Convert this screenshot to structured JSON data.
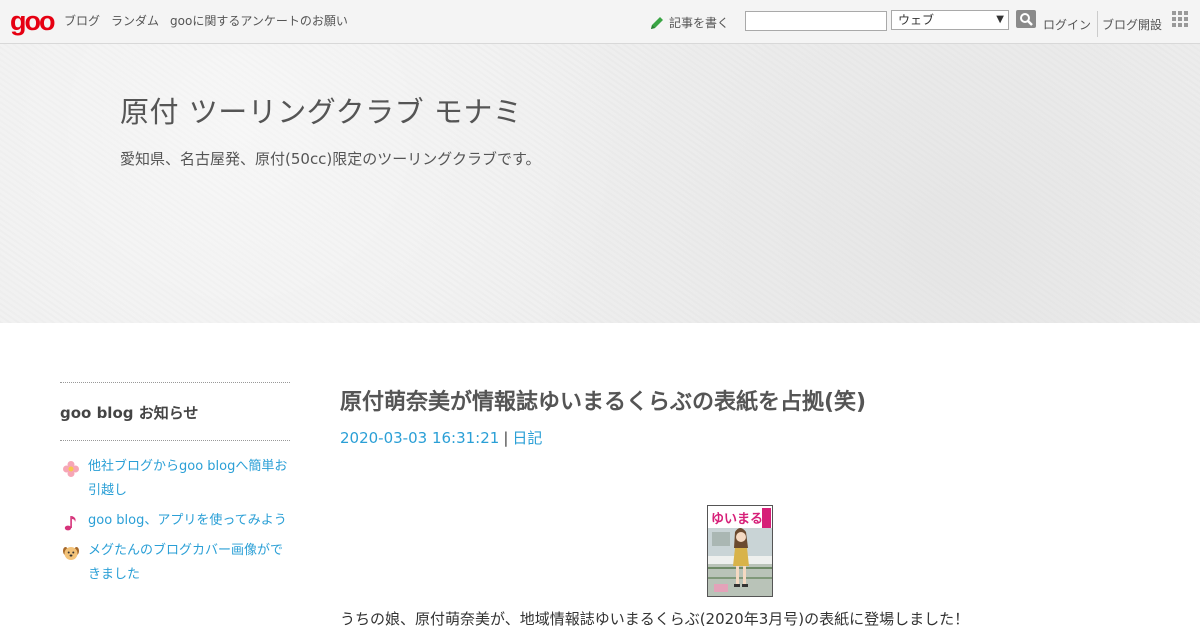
{
  "topbar": {
    "nav": [
      "ブログ",
      "ランダム",
      "gooに関するアンケートのお願い"
    ],
    "write_label": "記事を書く",
    "search": {
      "value": "",
      "select_value": "ウェブ"
    },
    "login_label": "ログイン",
    "open_label": "ブログ開設"
  },
  "header": {
    "title": "原付 ツーリングクラブ モナミ",
    "description": "愛知県、名古屋発、原付(50cc)限定のツーリングクラブです。"
  },
  "sidebar": {
    "heading": "goo blog お知らせ",
    "items": [
      {
        "label": "他社ブログからgoo blogへ簡単お引越し",
        "icon": "flower-icon"
      },
      {
        "label": "goo blog、アプリを使ってみよう",
        "icon": "music-note-icon"
      },
      {
        "label": "メグたんのブログカバー画像ができました",
        "icon": "dog-face-icon"
      }
    ]
  },
  "entry": {
    "title": "原付萌奈美が情報誌ゆいまるくらぶの表紙を占拠(笑)",
    "date": "2020-03-03 16:31:21",
    "separator": "|",
    "category": "日記",
    "cover_text": "ゆいまる",
    "body": "うちの娘、原付萌奈美が、地域情報誌ゆいまるくらぶ(2020年3月号)の表紙に登場しました！"
  },
  "colors": {
    "link": "#2a9fd6",
    "brand": "#e60012",
    "header_bg": "#efefef"
  }
}
